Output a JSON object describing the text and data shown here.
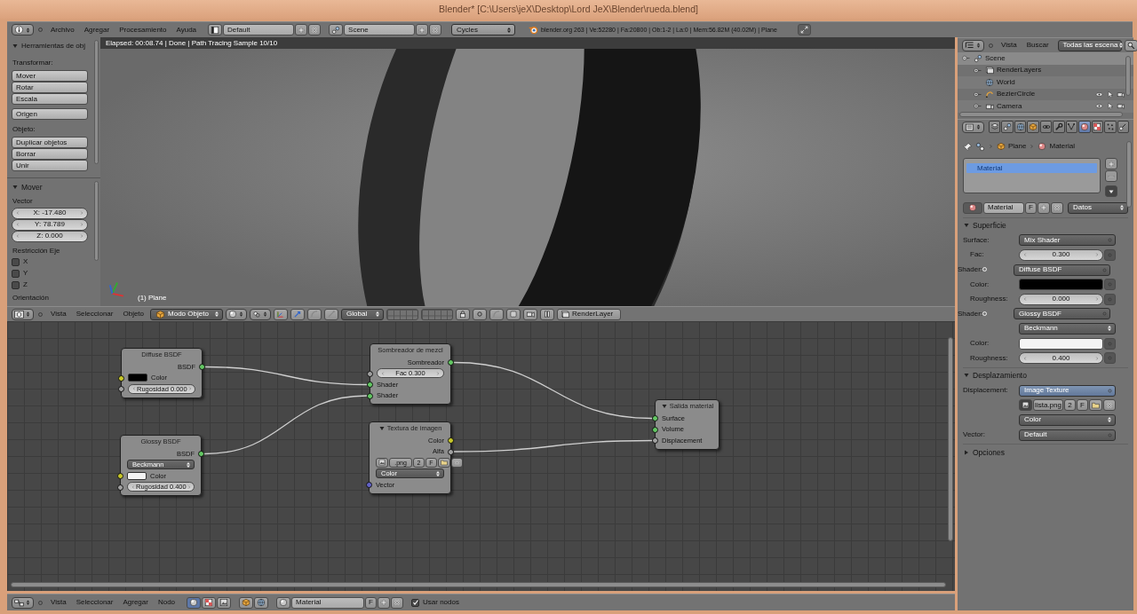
{
  "window": {
    "title": "Blender* [C:\\Users\\jeX\\Desktop\\Lord JeX\\Blender\\rueda.blend]"
  },
  "info_header": {
    "menus": [
      "Archivo",
      "Agregar",
      "Procesamiento",
      "Ayuda"
    ],
    "layout": "Default",
    "scene": "Scene",
    "engine": "Cycles",
    "stats": "blender.org 263 | Ve:52280 | Fa:20800 | Ob:1-2 | La:0 | Mem:56.82M (40.02M) | Plane"
  },
  "tool_shelf": {
    "title": "Herramientas de obj",
    "expanded": true,
    "groups": [
      {
        "label": "Transformar:",
        "buttons": [
          "Mover",
          "Rotar",
          "Escala"
        ]
      },
      {
        "buttons": [
          "Origen"
        ]
      },
      {
        "label": "Objeto:",
        "buttons": [
          "Duplicar objetos",
          "Borrar",
          "Unir"
        ]
      }
    ]
  },
  "operator_panel": {
    "title": "Mover",
    "expanded": true,
    "vector_label": "Vector",
    "fields": [
      "X: -17.480",
      "Y: 78.789",
      "Z: 0.000"
    ],
    "constraint_label": "Restricción Eje",
    "axes": [
      {
        "label": "X",
        "checked": false
      },
      {
        "label": "Y",
        "checked": false
      },
      {
        "label": "Z",
        "checked": false
      }
    ],
    "orientation_label": "Orientación"
  },
  "viewport": {
    "render_status": "Elapsed: 00:08.74 | Done | Path Tracing Sample 10/10",
    "object_label": "(1) Plane"
  },
  "view3d_header": {
    "menus": [
      "Vista",
      "Seleccionar",
      "Objeto"
    ],
    "mode": "Modo Objeto",
    "orientation": "Global",
    "render_layer": "RenderLayer"
  },
  "node_editor": {
    "nodes": [
      {
        "title": "Diffuse BSDF",
        "rows": [
          {
            "kind": "output",
            "label": "BSDF",
            "socket": {
              "color": "#63c763"
            }
          },
          {
            "kind": "color",
            "label": "Color",
            "color": "#000000",
            "socket": {
              "color": "#c7c729"
            }
          },
          {
            "kind": "slider",
            "label": "Rugosidad 0.000",
            "socket": {
              "color": "#a1a1a1"
            }
          }
        ]
      },
      {
        "title": "Glossy BSDF",
        "rows": [
          {
            "kind": "output",
            "label": "BSDF",
            "socket": {
              "color": "#63c763"
            }
          },
          {
            "kind": "select",
            "label": "Beckmann"
          },
          {
            "kind": "color",
            "label": "Color",
            "color": "#f4f4f4",
            "socket": {
              "color": "#c7c729"
            }
          },
          {
            "kind": "slider",
            "label": "Rugosidad 0.400",
            "socket": {
              "color": "#a1a1a1"
            }
          }
        ]
      },
      {
        "title": "Sombreador de mezcl",
        "rows": [
          {
            "kind": "output",
            "label": "Sombreador",
            "socket": {
              "color": "#63c763"
            }
          },
          {
            "kind": "slider",
            "label": "Fac 0.300",
            "socket": {
              "color": "#a1a1a1"
            }
          },
          {
            "kind": "input",
            "label": "Shader",
            "socket": {
              "color": "#63c763"
            }
          },
          {
            "kind": "input",
            "label": "Shader",
            "socket": {
              "color": "#63c763"
            }
          }
        ]
      },
      {
        "title": "Textura de imagen",
        "expanded": true,
        "rows": [
          {
            "kind": "output",
            "label": "Color",
            "socket": {
              "color": "#c7c729"
            }
          },
          {
            "kind": "output",
            "label": "Alfa",
            "socket": {
              "color": "#a1a1a1"
            }
          },
          {
            "kind": "image",
            "name": ".png",
            "users": "2",
            "fake_user": "F"
          },
          {
            "kind": "select",
            "label": "Color"
          },
          {
            "kind": "input",
            "label": "Vector",
            "socket": {
              "color": "#6363c7"
            }
          }
        ]
      },
      {
        "title": "Salida material",
        "expanded": true,
        "rows": [
          {
            "kind": "input",
            "label": "Surface",
            "socket": {
              "color": "#63c763"
            }
          },
          {
            "kind": "input",
            "label": "Volume",
            "socket": {
              "color": "#63c763"
            }
          },
          {
            "kind": "input",
            "label": "Displacement",
            "socket": {
              "color": "#a1a1a1"
            }
          }
        ]
      }
    ]
  },
  "node_header": {
    "menus": [
      "Vista",
      "Seleccionar",
      "Agregar",
      "Nodo"
    ],
    "material": "Material",
    "fake_user": "F",
    "use_nodes": {
      "label": "Usar nodos",
      "checked": true
    }
  },
  "outliner": {
    "menus": [
      "Vista",
      "Buscar"
    ],
    "filter": "Todas las escena",
    "tree": [
      {
        "label": "Scene",
        "kind": "scene",
        "expanded": true,
        "children": [
          {
            "label": "RenderLayers",
            "kind": "render_layers",
            "expanded": false
          },
          {
            "label": "World",
            "kind": "world"
          },
          {
            "label": "BezierCircle",
            "kind": "curve",
            "expanded": false,
            "visible": true
          },
          {
            "label": "Camera",
            "kind": "camera",
            "expanded": false,
            "visible": true
          }
        ]
      }
    ]
  },
  "properties": {
    "tabs": [
      {
        "selected": false
      },
      {
        "selected": false
      },
      {
        "selected": false
      },
      {
        "selected": false
      },
      {
        "selected": false
      },
      {
        "selected": false
      },
      {
        "selected": false
      },
      {
        "selected": true
      },
      {
        "selected": false
      },
      {
        "selected": false
      },
      {
        "selected": false
      }
    ],
    "breadcrumb": [
      "Plane",
      "Material"
    ],
    "slots": [
      {
        "label": "Material",
        "selected": true
      }
    ],
    "material": "Material",
    "fake_user": "F",
    "link": "Datos",
    "panels": [
      {
        "title": "Superficie",
        "expanded": true,
        "rows": [
          {
            "kind": "dropdown",
            "label": "Surface:",
            "value": "Mix Shader",
            "active": false
          },
          {
            "kind": "slider",
            "label": "Fac:",
            "value": "0.300"
          },
          {
            "kind": "dropdown",
            "label": "Shader:",
            "value": "Diffuse BSDF",
            "active": false,
            "linked": true
          },
          {
            "kind": "color",
            "label": "Color:",
            "color": "#000000"
          },
          {
            "kind": "slider",
            "label": "Roughness:",
            "value": "0.000"
          },
          {
            "kind": "dropdown",
            "label": "Shader:",
            "value": "Glossy BSDF",
            "active": false,
            "linked": true
          },
          {
            "kind": "select",
            "value": "Beckmann"
          },
          {
            "kind": "color",
            "label": "Color:",
            "color": "#f4f4f4"
          },
          {
            "kind": "slider",
            "label": "Roughness:",
            "value": "0.400"
          }
        ]
      },
      {
        "title": "Desplazamiento",
        "expanded": true,
        "rows": [
          {
            "kind": "dropdown",
            "label": "Displacement:",
            "value": "Image Texture",
            "active": true
          },
          {
            "kind": "image",
            "name": "lista.png",
            "users": "2",
            "fake_user": "F"
          },
          {
            "kind": "select",
            "value": "Color"
          },
          {
            "kind": "dropdown",
            "label": "Vector:",
            "value": "Default",
            "active": false
          }
        ]
      },
      {
        "title": "Opciones",
        "expanded": false
      }
    ]
  }
}
